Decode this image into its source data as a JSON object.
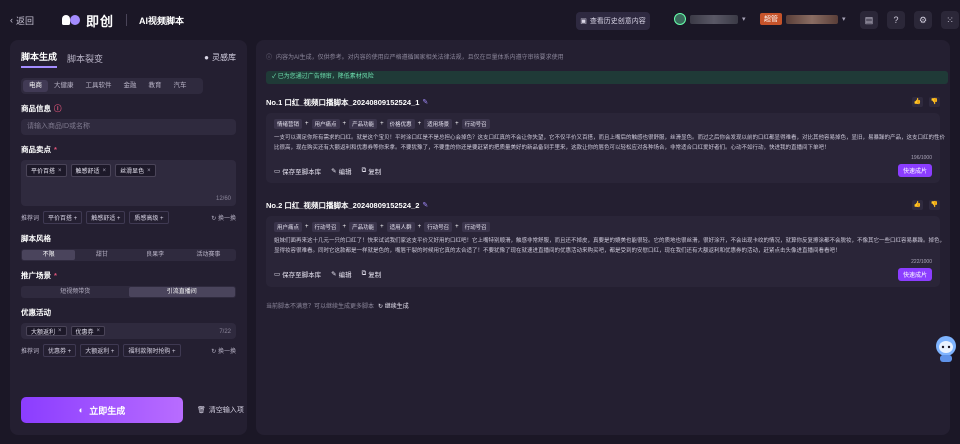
{
  "topbar": {
    "back_label": "返回",
    "brand": "即创",
    "module": "AI视频脚本",
    "history_button": "查看历史创意内容",
    "org_badge": "超管"
  },
  "left": {
    "tabs": [
      "脚本生成",
      "脚本裂变"
    ],
    "library": "灵感库",
    "categories": [
      "电商",
      "大健康",
      "工具软件",
      "金融",
      "教育",
      "汽车"
    ],
    "product_info": {
      "label": "商品信息",
      "placeholder": "请输入商品ID或名称"
    },
    "selling_points": {
      "label": "商品卖点",
      "chips": [
        "平价百搭",
        "触感舒适",
        "丝滑显色"
      ],
      "counter": "12/60",
      "rec_label": "推荐词",
      "rec_chips": [
        "平价百搭 +",
        "触感舒适 +",
        "质感高级 +"
      ],
      "swap": "换一换"
    },
    "style": {
      "label": "脚本风格",
      "options": [
        "不限",
        "甜甘",
        "良果李",
        "活动赛事"
      ]
    },
    "scene": {
      "label": "推广场景",
      "options": [
        "短视频带货",
        "引流直播间"
      ]
    },
    "promo": {
      "label": "优惠活动",
      "chips": [
        "大额返利",
        "优惠券"
      ],
      "counter": "7/22",
      "rec_label": "推荐词",
      "rec_chips": [
        "优惠券 +",
        "大额返利 +",
        "福利款限时抢购 +"
      ],
      "swap": "换一换"
    },
    "generate_button": "立即生成",
    "clear_button": "清空输入项"
  },
  "right": {
    "disclaimer": "内容为AI生成，仅供参考。对内容的使用应严格遵循国家相关法律法规，且仅在巨量体系内遵守审核要求使用",
    "green_bar": "已为您通过广告频审，降低素材风险",
    "cards": [
      {
        "title": "No.1 口红_视频口播脚本_20240809152524_1",
        "tags": [
          "情绪营销",
          "用户痛点",
          "产品功能",
          "价格优惠",
          "适用场景",
          "行动号召"
        ],
        "text": "一支可以满足你所有需求的口红。就是这个宝贝！平时涂口红是不是总担心会掉色？这支口红真的不会让你失望，它不仅平价又百搭，而且上嘴后的触感也很舒服，丝滑显色。而过之后你会发现以前的口红都显得难看，对比其他容易掉色，显旧，易暴躁的产品，这支口红的性价比很高，现在购买还有大额返利和优惠券等你来拿。不要犹豫了，不要重的你还是要赶紧的把质量美好的新品备到手里来，这款让你的唇色可以轻松应对各种场合，非常适合口红爱好者们。心动不如行动，快进我的直播间下单吧！",
        "counter": "196/1000",
        "actions": [
          "保存至脚本库",
          "编辑",
          "复制"
        ],
        "fast": "快速成片"
      },
      {
        "title": "No.2 口红_视频口播脚本_20240809152524_2",
        "tags": [
          "用户痛点",
          "行动号召",
          "产品功能",
          "适用人群",
          "行动号召",
          "行动号召"
        ],
        "text": "姐妹们面再来这十几元一只的口红了！快来试试我们家这支平价又好用的口红吧！它上嘴特别顺滑，触感非常舒服，而且还不掉皮，真要是的媲美也能很轻。它的质地也很丝滑，很好涂开，不会出现卡纹的情况，就算你反复擦涂都不会脱妆，不像其它一些口红容易暴躁。掉色，显得妆容很难看。同时它这款都是一样就是色的，嘴唇干裂的时候用它真的太合适了！不要犹豫了现在就速进直播间的优惠活动来购买吧，都是受到的安慰口红，现在我们还有大额返利和优惠券的活动，赶紧点击头像进直播间看看吧！",
        "counter": "222/1000",
        "actions": [
          "保存至脚本库",
          "编辑",
          "复制"
        ],
        "fast": "快速成片"
      }
    ],
    "bottom_note": "当前脚本不满意？可以继续生成更多脚本",
    "continue": "继续生成"
  }
}
